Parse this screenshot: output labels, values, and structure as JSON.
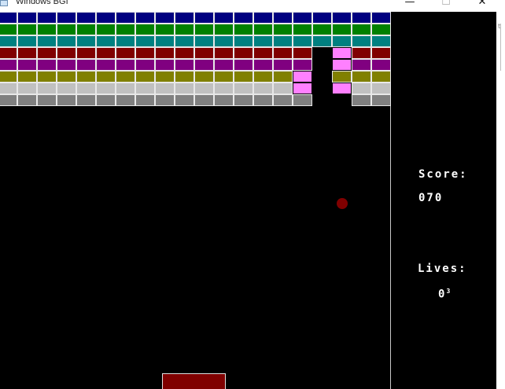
{
  "window": {
    "title": "Windows BGI",
    "minimize_glyph": "—",
    "maximize_glyph": "☐",
    "close_glyph": "✕",
    "icon": "window-app-icon"
  },
  "game": {
    "background_color": "#000000",
    "row_colors": [
      "#000080",
      "#008000",
      "#008080",
      "#800000",
      "#800080",
      "#808000",
      "#c0c0c0",
      "#808080"
    ],
    "hit_brick_color": "#ff80ff",
    "brick_rows": 8,
    "brick_columns": 20,
    "destroyed_bricks": [
      [
        3,
        16
      ],
      [
        4,
        16
      ],
      [
        5,
        16
      ],
      [
        6,
        16
      ],
      [
        7,
        16
      ],
      [
        6,
        17
      ],
      [
        7,
        17
      ]
    ],
    "hit_bricks": [
      [
        3,
        17
      ],
      [
        4,
        17
      ],
      [
        5,
        15
      ],
      [
        6,
        15
      ],
      [
        6,
        17
      ]
    ],
    "ball_color": "#800000",
    "paddle_color": "#800000"
  },
  "hud": {
    "score_label": "Score:",
    "score_value": "070",
    "lives_label": "Lives:",
    "lives_value": "0",
    "lives_sup": "3"
  }
}
